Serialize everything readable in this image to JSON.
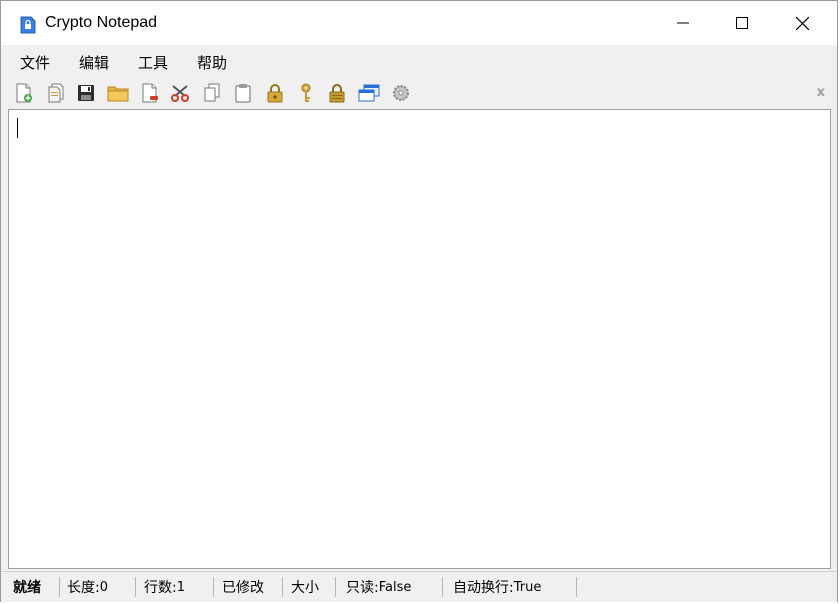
{
  "window": {
    "title": "Crypto Notepad"
  },
  "menu": {
    "items": [
      "文件",
      "编辑",
      "工具",
      "帮助"
    ]
  },
  "toolbar": {
    "icons": [
      "new-file-icon",
      "open-file-icon",
      "save-icon",
      "folder-icon",
      "delete-file-icon",
      "cut-icon",
      "copy-icon",
      "paste-icon",
      "lock-icon",
      "key-icon",
      "encrypt-lock-icon",
      "windows-icon",
      "settings-icon"
    ],
    "close_label": "x"
  },
  "editor": {
    "text": ""
  },
  "status": {
    "ready": "就绪",
    "length_label": "长度:",
    "length_value": "0",
    "lines_label": "行数:",
    "lines_value": "1",
    "modified": "已修改",
    "size": "大小",
    "readonly_label": "只读:",
    "readonly_value": "False",
    "wordwrap_label": "自动换行:",
    "wordwrap_value": "True"
  },
  "colors": {
    "chrome": "#f0f0f0",
    "accent": "#2b6fd6",
    "gold": "#c79a2e",
    "red": "#d23a2a"
  }
}
